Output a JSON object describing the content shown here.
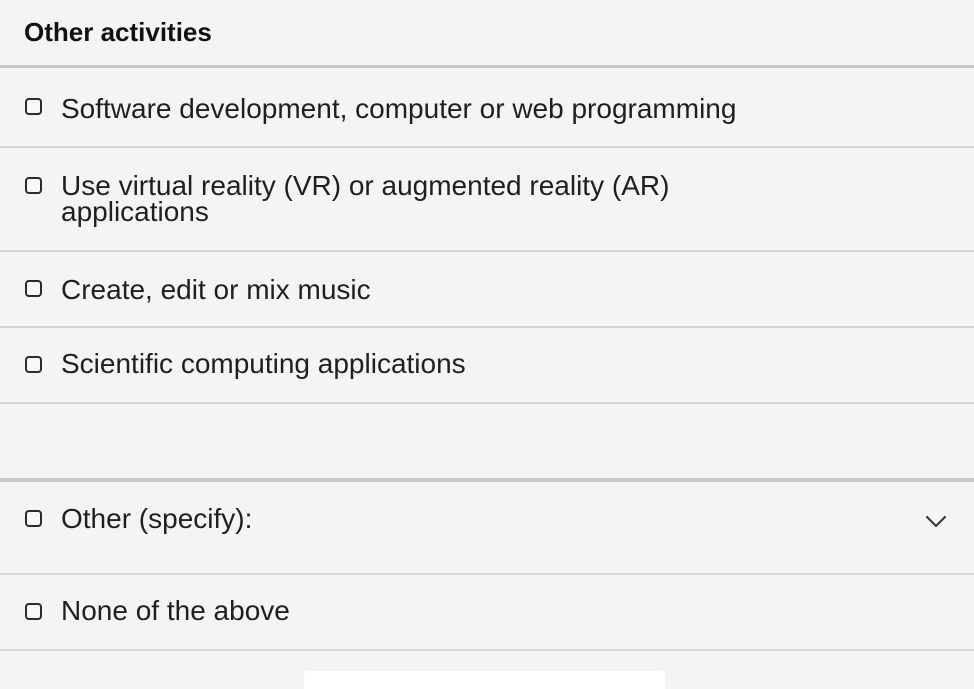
{
  "section": {
    "title": "Other activities"
  },
  "options": [
    {
      "label": "Software development, computer or web programming",
      "checked": false
    },
    {
      "label": "Use virtual reality (VR) or augmented reality (AR) applications",
      "checked": false
    },
    {
      "label": "Create, edit or mix music",
      "checked": false
    },
    {
      "label": "Scientific computing applications",
      "checked": false
    },
    {
      "label": "Other (specify):",
      "checked": false
    },
    {
      "label": "None of the above",
      "checked": false
    }
  ],
  "icons": {
    "checkbox": "checkbox-icon",
    "other_dropdown": "chevron-down-icon"
  }
}
